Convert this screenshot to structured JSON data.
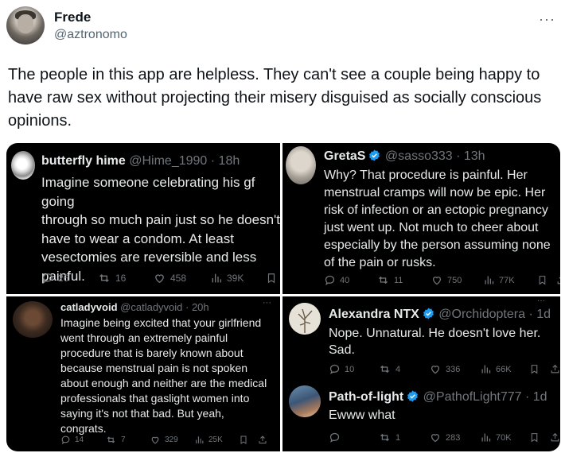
{
  "post": {
    "author": "Frede",
    "handle": "@aztronomo",
    "more": "···",
    "text": "The people in this app are helpless. They can't see a couple being happy to have raw sex without projecting their misery disguised as socially conscious opinions."
  },
  "screenshots": [
    {
      "name": "butterfly hime",
      "meta": "@Hime_1990 · 18h",
      "body": "Imagine someone celebrating his gf going\nthrough so much pain just so he doesn't\nhave to wear a condom. At least\nvesectomies are reversible and less\npainful.",
      "replies": "26",
      "reposts": "16",
      "likes": "458",
      "views": "39K"
    },
    {
      "name": "GretaS",
      "meta": "@sasso333 · 13h",
      "body": "Why? That procedure is painful. Her\nmenstrual cramps will now be epic. Her\nrisk of infection or an ectopic pregnancy\njust went up.  Not much to cheer about\nespecially by the person assuming none\nof the pain or rusks.",
      "replies": "40",
      "reposts": "11",
      "likes": "750",
      "views": "77K"
    },
    {
      "name": "catladyvoid",
      "meta": "@catladyvoid · 20h",
      "more": "···",
      "body": "Imagine being excited that your girlfriend\nwent through an extremely painful\nprocedure that is barely known about\nbecause menstrual pain is not spoken\nabout enough and neither are the medical\nprofessionals that gaslight women into\nsaying it's not that bad. But yeah,\ncongrats.",
      "replies": "14",
      "reposts": "7",
      "likes": "329",
      "views": "25K"
    },
    {
      "name": "Alexandra NTX",
      "meta": "@Orchidoptera · 1d",
      "more": "···",
      "body": "Nope. Unnatural. He doesn't love her.\nSad.",
      "replies": "10",
      "reposts": "4",
      "likes": "336",
      "views": "66K"
    },
    {
      "name": "Path-of-light",
      "meta": "@PathofLight777 · 1d",
      "body": "Ewww what",
      "replies": "",
      "reposts": "1",
      "likes": "283",
      "views": "70K"
    }
  ],
  "colors": {
    "verified": "#1d9bf0",
    "muted": "#71767b",
    "dark_bg": "#000000"
  },
  "icons": [
    "reply-icon",
    "repost-icon",
    "like-icon",
    "views-icon",
    "bookmark-icon",
    "share-icon",
    "verified-icon",
    "more-icon"
  ]
}
